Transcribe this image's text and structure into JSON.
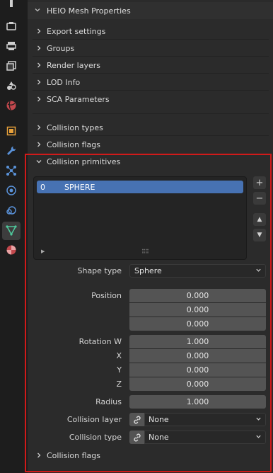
{
  "panel": {
    "title": "HEIO Mesh Properties",
    "sections": [
      {
        "label": "Export settings"
      },
      {
        "label": "Groups"
      },
      {
        "label": "Render layers"
      },
      {
        "label": "LOD Info"
      },
      {
        "label": "SCA Parameters"
      },
      {
        "label": "Collision types"
      },
      {
        "label": "Collision flags"
      }
    ],
    "collision_primitives": {
      "label": "Collision primitives",
      "list": [
        {
          "index": "0",
          "name": "SPHERE"
        }
      ],
      "buttons": {
        "add": "+",
        "remove": "−",
        "up": "▲",
        "down": "▼"
      },
      "shape_type": {
        "label": "Shape type",
        "value": "Sphere"
      },
      "position": {
        "label": "Position",
        "values": [
          "0.000",
          "0.000",
          "0.000"
        ]
      },
      "rotation": [
        {
          "label": "Rotation W",
          "value": "1.000"
        },
        {
          "label": "X",
          "value": "0.000"
        },
        {
          "label": "Y",
          "value": "0.000"
        },
        {
          "label": "Z",
          "value": "0.000"
        }
      ],
      "radius": {
        "label": "Radius",
        "value": "1.000"
      },
      "collision_layer": {
        "label": "Collision layer",
        "value": "None"
      },
      "collision_type": {
        "label": "Collision type",
        "value": "None"
      },
      "collision_flags": {
        "label": "Collision flags"
      }
    }
  },
  "tabs": [
    {
      "icon": "tool-icon"
    },
    {
      "icon": "render-icon"
    },
    {
      "icon": "output-icon"
    },
    {
      "icon": "view-layer-icon"
    },
    {
      "icon": "scene-icon"
    },
    {
      "icon": "world-icon"
    },
    {
      "icon": "object-icon"
    },
    {
      "icon": "modifier-icon"
    },
    {
      "icon": "particles-icon"
    },
    {
      "icon": "physics-icon"
    },
    {
      "icon": "constraints-icon"
    },
    {
      "icon": "mesh-data-icon"
    },
    {
      "icon": "material-icon"
    }
  ],
  "colors": {
    "accent": "#4772b3",
    "highlight_border": "#d11a1a"
  }
}
